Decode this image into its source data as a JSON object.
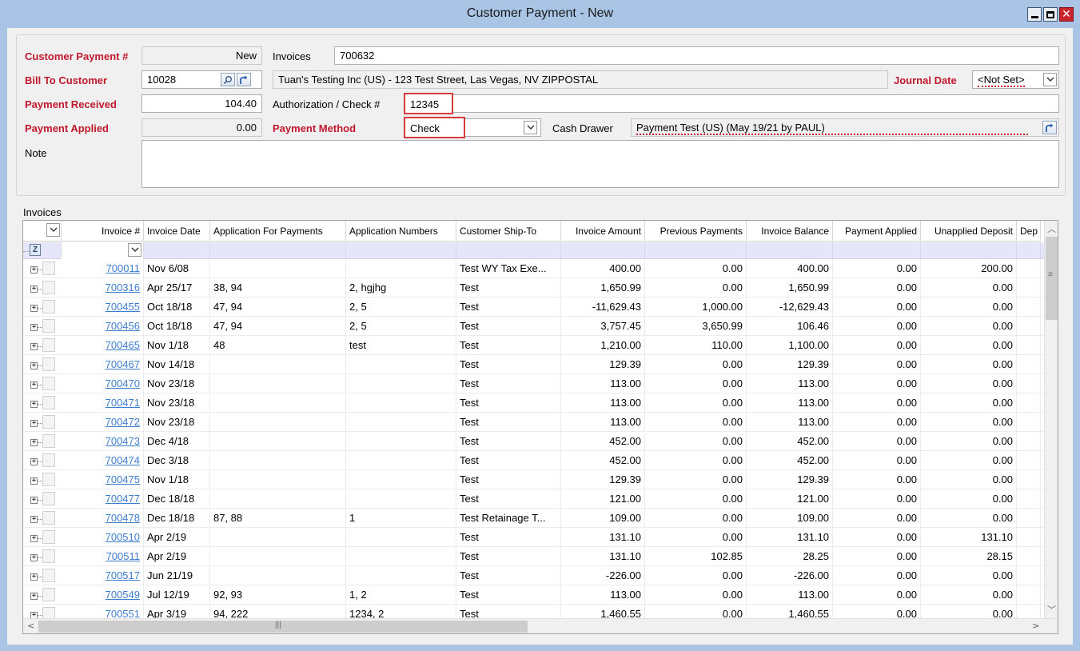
{
  "window": {
    "title": "Customer Payment - New"
  },
  "form": {
    "customer_payment_label": "Customer Payment #",
    "customer_payment_value": "New",
    "invoices_label": "Invoices",
    "invoices_value": "700632",
    "bill_to_label": "Bill To Customer",
    "bill_to_value": "10028",
    "customer_description": "Tuan's Testing Inc (US) - 123 Test Street, Las Vegas, NV  ZIPPOSTAL",
    "journal_date_label": "Journal Date",
    "journal_date_value": "<Not Set>",
    "payment_received_label": "Payment Received",
    "payment_received_value": "104.40",
    "auth_check_label": "Authorization / Check #",
    "auth_check_value": "12345",
    "payment_applied_label": "Payment Applied",
    "payment_applied_value": "0.00",
    "payment_method_label": "Payment Method",
    "payment_method_value": "Check",
    "cash_drawer_label": "Cash Drawer",
    "cash_drawer_value": "Payment Test (US) (May 19/21 by PAUL)",
    "note_label": "Note",
    "note_value": ""
  },
  "invoices_group_label": "Invoices",
  "grid": {
    "columns": [
      "Invoice #",
      "Invoice Date",
      "Application For Payments",
      "Application Numbers",
      "Customer Ship-To",
      "Invoice Amount",
      "Previous Payments",
      "Invoice Balance",
      "Payment Applied",
      "Unapplied Deposit",
      "Dep"
    ],
    "rows": [
      [
        "700011",
        "Nov 6/08",
        "",
        "",
        "Test WY Tax Exe...",
        "400.00",
        "0.00",
        "400.00",
        "0.00",
        "200.00"
      ],
      [
        "700316",
        "Apr 25/17",
        "38, 94",
        "2, hgjhg",
        "Test",
        "1,650.99",
        "0.00",
        "1,650.99",
        "0.00",
        "0.00"
      ],
      [
        "700455",
        "Oct 18/18",
        "47, 94",
        "2, 5",
        "Test",
        "-11,629.43",
        "1,000.00",
        "-12,629.43",
        "0.00",
        "0.00"
      ],
      [
        "700456",
        "Oct 18/18",
        "47, 94",
        "2, 5",
        "Test",
        "3,757.45",
        "3,650.99",
        "106.46",
        "0.00",
        "0.00"
      ],
      [
        "700465",
        "Nov 1/18",
        "48",
        "test",
        "Test",
        "1,210.00",
        "110.00",
        "1,100.00",
        "0.00",
        "0.00"
      ],
      [
        "700467",
        "Nov 14/18",
        "",
        "",
        "Test",
        "129.39",
        "0.00",
        "129.39",
        "0.00",
        "0.00"
      ],
      [
        "700470",
        "Nov 23/18",
        "",
        "",
        "Test",
        "113.00",
        "0.00",
        "113.00",
        "0.00",
        "0.00"
      ],
      [
        "700471",
        "Nov 23/18",
        "",
        "",
        "Test",
        "113.00",
        "0.00",
        "113.00",
        "0.00",
        "0.00"
      ],
      [
        "700472",
        "Nov 23/18",
        "",
        "",
        "Test",
        "113.00",
        "0.00",
        "113.00",
        "0.00",
        "0.00"
      ],
      [
        "700473",
        "Dec 4/18",
        "",
        "",
        "Test",
        "452.00",
        "0.00",
        "452.00",
        "0.00",
        "0.00"
      ],
      [
        "700474",
        "Dec 3/18",
        "",
        "",
        "Test",
        "452.00",
        "0.00",
        "452.00",
        "0.00",
        "0.00"
      ],
      [
        "700475",
        "Nov 1/18",
        "",
        "",
        "Test",
        "129.39",
        "0.00",
        "129.39",
        "0.00",
        "0.00"
      ],
      [
        "700477",
        "Dec 18/18",
        "",
        "",
        "Test",
        "121.00",
        "0.00",
        "121.00",
        "0.00",
        "0.00"
      ],
      [
        "700478",
        "Dec 18/18",
        "87, 88",
        "1",
        "Test Retainage T...",
        "109.00",
        "0.00",
        "109.00",
        "0.00",
        "0.00"
      ],
      [
        "700510",
        "Apr 2/19",
        "",
        "",
        "Test",
        "131.10",
        "0.00",
        "131.10",
        "0.00",
        "131.10"
      ],
      [
        "700511",
        "Apr 2/19",
        "",
        "",
        "Test",
        "131.10",
        "102.85",
        "28.25",
        "0.00",
        "28.15"
      ],
      [
        "700517",
        "Jun 21/19",
        "",
        "",
        "Test",
        "-226.00",
        "0.00",
        "-226.00",
        "0.00",
        "0.00"
      ],
      [
        "700549",
        "Jul 12/19",
        "92, 93",
        "1, 2",
        "Test",
        "113.00",
        "0.00",
        "113.00",
        "0.00",
        "0.00"
      ],
      [
        "700551",
        "Apr 3/19",
        "94, 222",
        "1234, 2",
        "Test",
        "1,460.55",
        "0.00",
        "1,460.55",
        "0.00",
        "0.00"
      ]
    ]
  }
}
